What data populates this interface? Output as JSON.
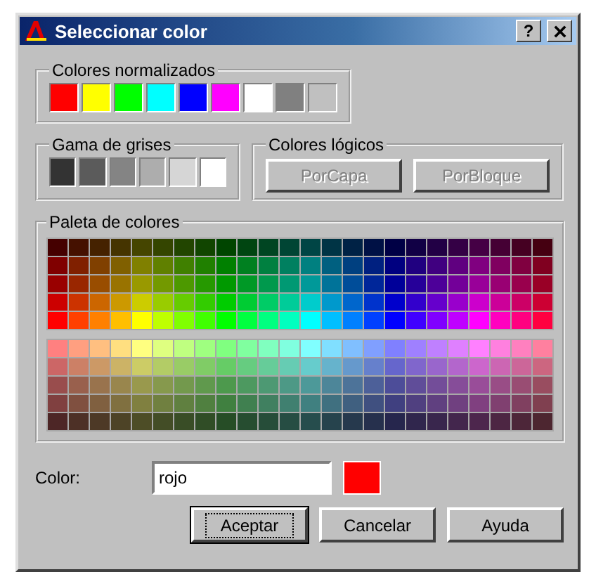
{
  "window": {
    "title": "Seleccionar color",
    "help_button": "?"
  },
  "standard_colors": {
    "label": "Colores normalizados",
    "swatches": [
      {
        "color": "#ff0000"
      },
      {
        "color": "#ffff00"
      },
      {
        "color": "#00ff00"
      },
      {
        "color": "#00ffff"
      },
      {
        "color": "#0000ff"
      },
      {
        "color": "#ff00ff"
      },
      {
        "color": "#ffffff"
      },
      {
        "color": "#808080"
      },
      {
        "color": "#c0c0c0"
      }
    ]
  },
  "gray_shades": {
    "label": "Gama de grises",
    "swatches": [
      {
        "color": "#333333"
      },
      {
        "color": "#5b5b5b"
      },
      {
        "color": "#848484"
      },
      {
        "color": "#adadad"
      },
      {
        "color": "#d6d6d6"
      },
      {
        "color": "#ffffff"
      }
    ]
  },
  "logical_colors": {
    "label": "Colores lógicos",
    "buttons": [
      {
        "label": "PorCapa",
        "disabled": true
      },
      {
        "label": "PorBloque",
        "disabled": true
      }
    ]
  },
  "palette": {
    "label": "Paleta de colores"
  },
  "color_field": {
    "label": "Color:",
    "value": "rojo",
    "color": "#ff0000"
  },
  "buttons": [
    {
      "label": "Aceptar",
      "default": true
    },
    {
      "label": "Cancelar",
      "default": false
    },
    {
      "label": "Ayuda",
      "default": false
    }
  ]
}
